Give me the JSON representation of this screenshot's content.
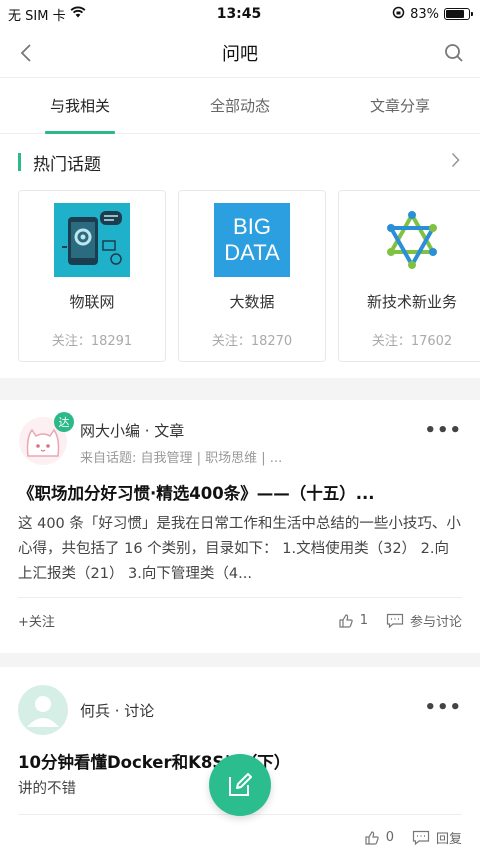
{
  "status": {
    "carrier": "无 SIM 卡",
    "time": "13:45",
    "battery": "83%",
    "battery_level": 0.83
  },
  "nav": {
    "title": "问吧"
  },
  "tabs": [
    {
      "label": "与我相关",
      "active": true
    },
    {
      "label": "全部动态",
      "active": false
    },
    {
      "label": "文章分享",
      "active": false
    }
  ],
  "hot_topics": {
    "title": "热门话题",
    "items": [
      {
        "name": "物联网",
        "follow": "关注：18291",
        "icon": "iot-phone-icon"
      },
      {
        "name": "大数据",
        "follow": "关注：18270",
        "image_text_1": "BIG",
        "image_text_2": "DATA"
      },
      {
        "name": "新技术新业务",
        "follow": "关注：17602",
        "icon": "network-star-icon"
      }
    ]
  },
  "posts": [
    {
      "author": "网大小编 · 文章",
      "badge": "达",
      "from": "来自话题:  自我管理 | 职场思维 | ...",
      "title": "《职场加分好习惯·精选400条》——（十五）...",
      "body": "这 400 条「好习惯」是我在日常工作和生活中总结的一些小技巧、小心得，共包括了 16 个类别，目录如下： 1.文档使用类（32） 2.向上汇报类（21） 3.向下管理类（4...",
      "follow": "+关注",
      "likes": "1",
      "comment_label": "参与讨论"
    },
    {
      "author": "何兵 · 讨论",
      "title": "10分钟看懂Docker和K8S以（下）",
      "body": "讲的不错",
      "likes": "0",
      "comment_label": "回复"
    }
  ],
  "colors": {
    "accent": "#2bb989"
  }
}
